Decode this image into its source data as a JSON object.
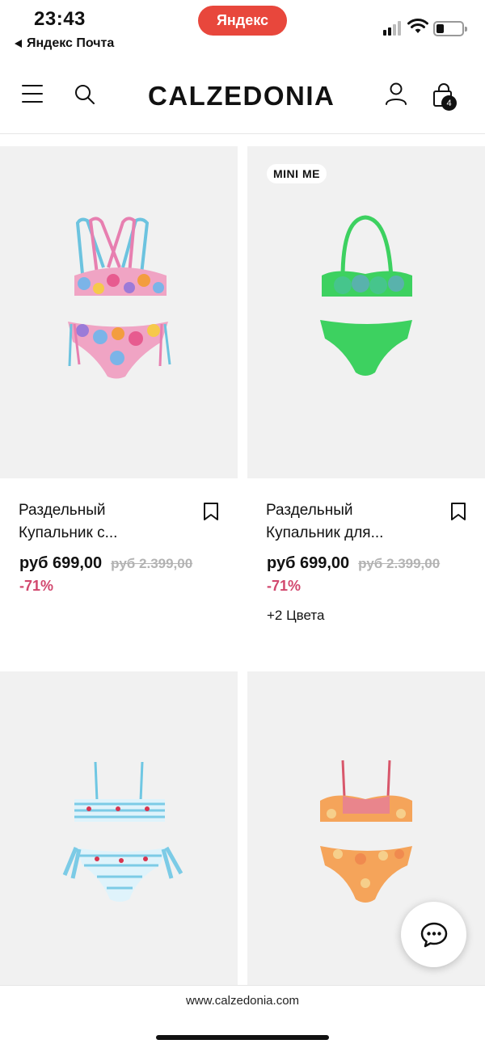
{
  "status_bar": {
    "time": "23:43",
    "back_app": "Яндекс Почта",
    "pill_label": "Яндекс",
    "pill_color": "#e8473c"
  },
  "header": {
    "logo": "CALZEDONIA",
    "bag_count": "4",
    "icons": [
      "menu-icon",
      "search-icon",
      "user-icon",
      "shopping-bag-icon"
    ]
  },
  "products": [
    {
      "badge": "",
      "title_line1": "Раздельный",
      "title_line2": "Купальник с...",
      "price_new": "руб 699,00",
      "price_old": "руб 2.399,00",
      "discount": "-71%",
      "colors_more": ""
    },
    {
      "badge": "MINI ME",
      "title_line1": "Раздельный",
      "title_line2": "Купальник для...",
      "price_new": "руб 699,00",
      "price_old": "руб 2.399,00",
      "discount": "-71%",
      "colors_more": "+2 Цвета"
    },
    {
      "badge": ""
    },
    {
      "badge": ""
    }
  ],
  "footer": {
    "url": "www.calzedonia.com"
  },
  "colors": {
    "discount": "#d2486e",
    "card_background": "#f1f1f1"
  }
}
